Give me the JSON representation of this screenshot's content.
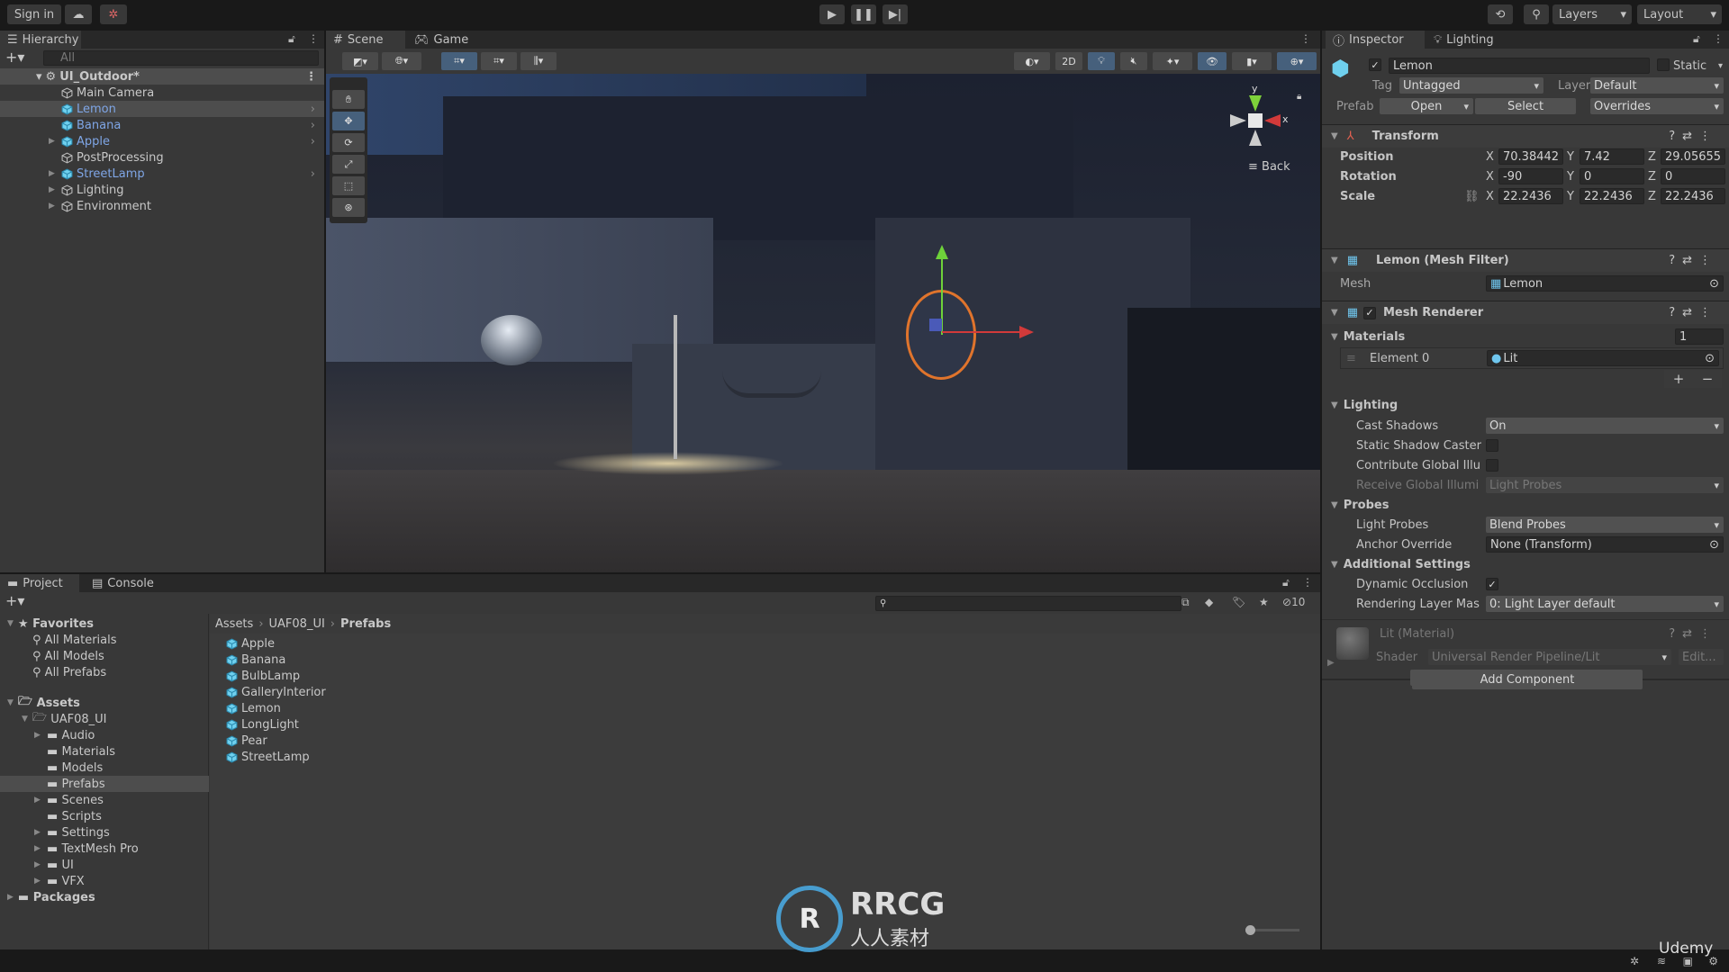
{
  "topbar": {
    "sign_in": "Sign in",
    "cloud_icon": "cloud-icon",
    "collab_icon": "collab-icon",
    "play_icon": "play-icon",
    "pause_icon": "pause-icon",
    "step_icon": "step-icon",
    "history_icon": "history-icon",
    "search_icon": "search-icon",
    "layers": "Layers",
    "layout": "Layout"
  },
  "hierarchy": {
    "tab": "Hierarchy",
    "search_placeholder": "All",
    "scene": "UI_Outdoor*",
    "items": [
      {
        "label": "Main Camera",
        "prefab": false,
        "expandable": false
      },
      {
        "label": "Lemon",
        "prefab": true,
        "expandable": false,
        "selected": true
      },
      {
        "label": "Banana",
        "prefab": true,
        "expandable": false
      },
      {
        "label": "Apple",
        "prefab": true,
        "expandable": true
      },
      {
        "label": "PostProcessing",
        "prefab": false,
        "expandable": false
      },
      {
        "label": "StreetLamp",
        "prefab": true,
        "expandable": true
      },
      {
        "label": "Lighting",
        "prefab": false,
        "expandable": true
      },
      {
        "label": "Environment",
        "prefab": false,
        "expandable": true
      }
    ]
  },
  "scene": {
    "tabs": [
      "Scene",
      "Game"
    ],
    "toggle_2d": "2D",
    "gizmo_back": "Back",
    "axis_y": "y",
    "axis_x": "x",
    "tools": [
      "hand-tool",
      "move-tool",
      "rotate-tool",
      "scale-tool",
      "rect-tool",
      "transform-tool"
    ]
  },
  "inspector": {
    "tabs": [
      "Inspector",
      "Lighting"
    ],
    "object_name": "Lemon",
    "active": true,
    "static_label": "Static",
    "tag_label": "Tag",
    "tag_value": "Untagged",
    "layer_label": "Layer",
    "layer_value": "Default",
    "prefab_label": "Prefab",
    "open": "Open",
    "select": "Select",
    "overrides": "Overrides",
    "transform": {
      "title": "Transform",
      "position_label": "Position",
      "rotation_label": "Rotation",
      "scale_label": "Scale",
      "position": {
        "x": "70.38442",
        "y": "7.42",
        "z": "29.05655"
      },
      "rotation": {
        "x": "-90",
        "y": "0",
        "z": "0"
      },
      "scale": {
        "x": "22.2436",
        "y": "22.2436",
        "z": "22.2436"
      }
    },
    "mesh_filter": {
      "title": "Lemon (Mesh Filter)",
      "mesh_label": "Mesh",
      "mesh_value": "Lemon"
    },
    "mesh_renderer": {
      "title": "Mesh Renderer",
      "enabled": true,
      "materials_label": "Materials",
      "materials_count": "1",
      "element0_label": "Element 0",
      "element0_value": "Lit",
      "lighting_label": "Lighting",
      "cast_shadows_label": "Cast Shadows",
      "cast_shadows_value": "On",
      "static_shadow_label": "Static Shadow Caster",
      "contribute_gi_label": "Contribute Global Illu",
      "receive_gi_label": "Receive Global Illumi",
      "receive_gi_value": "Light Probes",
      "probes_label": "Probes",
      "light_probes_label": "Light Probes",
      "light_probes_value": "Blend Probes",
      "anchor_label": "Anchor Override",
      "anchor_value": "None (Transform)",
      "additional_label": "Additional Settings",
      "dynamic_occlusion_label": "Dynamic Occlusion",
      "dynamic_occlusion": true,
      "rendering_layer_label": "Rendering Layer Mas",
      "rendering_layer_value": "0: Light Layer default"
    },
    "material": {
      "title": "Lit (Material)",
      "shader_label": "Shader",
      "shader_value": "Universal Render Pipeline/Lit",
      "edit": "Edit..."
    },
    "add_component": "Add Component"
  },
  "project": {
    "tabs": [
      "Project",
      "Console"
    ],
    "hidden_count": "10",
    "favorites_label": "Favorites",
    "favorites": [
      "All Materials",
      "All Models",
      "All Prefabs"
    ],
    "assets_label": "Assets",
    "root_folder": "UAF08_UI",
    "folders": [
      {
        "label": "Audio",
        "expandable": true
      },
      {
        "label": "Materials",
        "expandable": false
      },
      {
        "label": "Models",
        "expandable": false
      },
      {
        "label": "Prefabs",
        "expandable": false,
        "selected": true
      },
      {
        "label": "Scenes",
        "expandable": true
      },
      {
        "label": "Scripts",
        "expandable": false
      },
      {
        "label": "Settings",
        "expandable": true
      },
      {
        "label": "TextMesh Pro",
        "expandable": true
      },
      {
        "label": "UI",
        "expandable": true
      },
      {
        "label": "VFX",
        "expandable": true
      }
    ],
    "packages_label": "Packages",
    "breadcrumb": [
      "Assets",
      "UAF08_UI",
      "Prefabs"
    ],
    "files": [
      "Apple",
      "Banana",
      "BulbLamp",
      "GalleryInterior",
      "Lemon",
      "LongLight",
      "Pear",
      "StreetLamp"
    ]
  },
  "watermarks": {
    "rrcg": "RRCG",
    "rrcg_cn": "人人素材",
    "udemy": "Udemy"
  },
  "colors": {
    "accent": "#46607c",
    "prefab_blue": "#7fa6e6",
    "panel": "#383838"
  }
}
